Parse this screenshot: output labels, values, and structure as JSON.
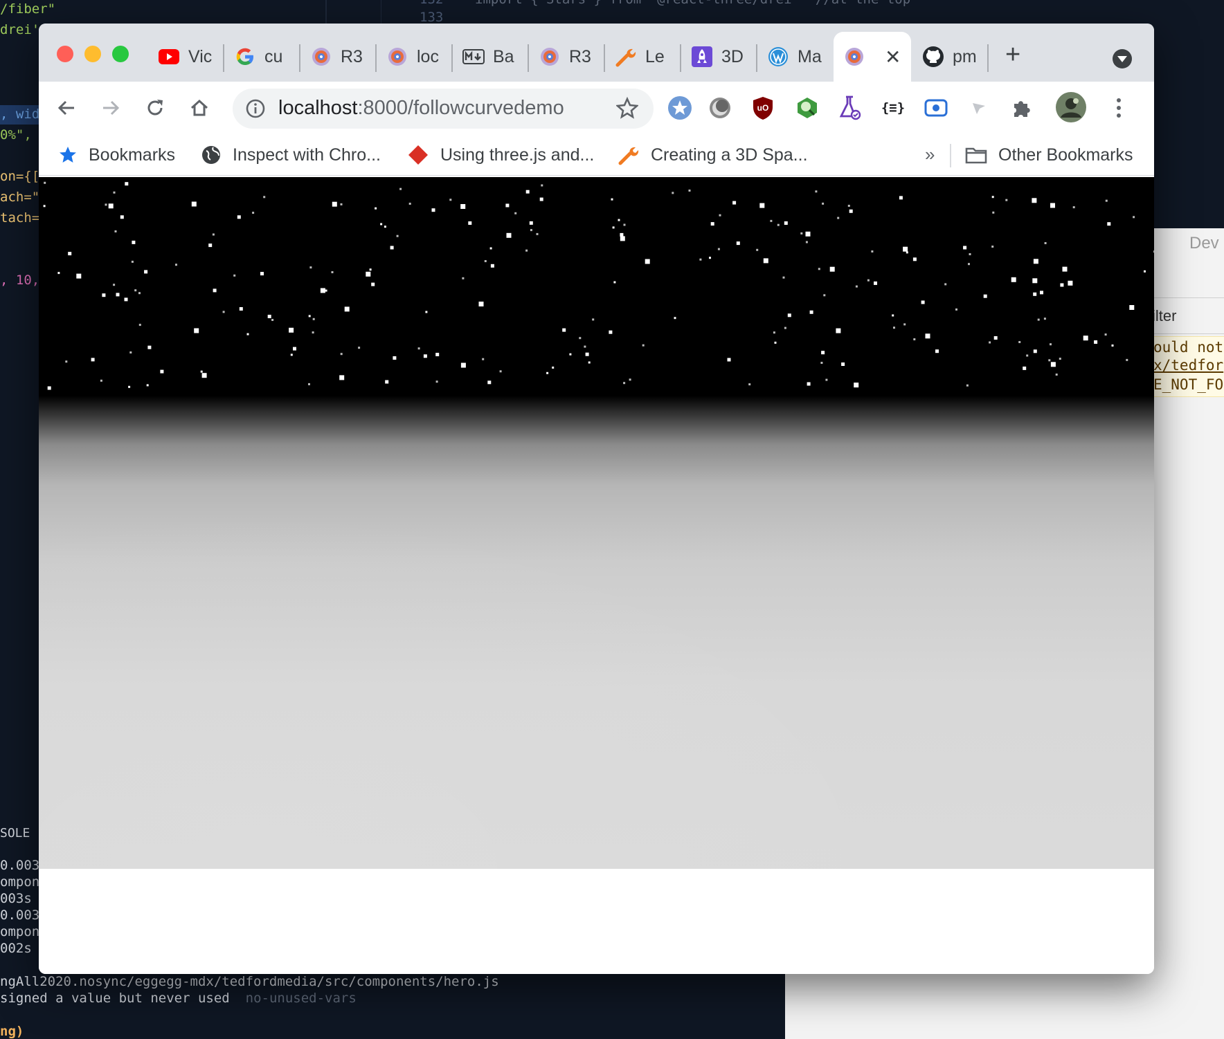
{
  "editor": {
    "top_fragments": [
      "/fiber\"",
      "drei'"
    ],
    "code_line_1": "import { Stars } from '@react-three/drei'  //at the top",
    "line_no_132": "132",
    "line_no_133": "133",
    "left_fragments": [
      ", wid",
      "0%\", ",
      "on={[",
      "ach=\"",
      "tach=\"",
      ", 10,"
    ],
    "console_label": "SOLE",
    "console_lines": [
      "0.003s",
      "ompone",
      "003s",
      "0.003s",
      "ompone",
      "002s"
    ],
    "path_line": "ngAll2020.nosync/eggegg-mdx/tedfordmedia/src/components/hero.js",
    "warn_line": "signed a value but never used",
    "warn_rule": "no-unused-vars",
    "last_line": "ng)"
  },
  "devtools": {
    "title": "Dev",
    "filter": "ilter",
    "error_lines": [
      "ould not",
      "x/tedfor",
      "E_NOT_FO"
    ]
  },
  "browser": {
    "tabs": [
      {
        "label": "Vic",
        "icon": "youtube-icon"
      },
      {
        "label": "cu",
        "icon": "google-icon"
      },
      {
        "label": "R3",
        "icon": "r3f-icon"
      },
      {
        "label": "loc",
        "icon": "r3f-icon"
      },
      {
        "label": "Ba",
        "icon": "markdown-icon"
      },
      {
        "label": "R3",
        "icon": "r3f-icon"
      },
      {
        "label": "Le",
        "icon": "wrench-icon"
      },
      {
        "label": "3D",
        "icon": "rocket-icon"
      },
      {
        "label": "Ma",
        "icon": "wordpress-icon"
      },
      {
        "label": "",
        "icon": "r3f-icon",
        "active": true
      },
      {
        "label": "pm",
        "icon": "github-icon"
      }
    ],
    "new_tab": "+",
    "address": {
      "host": "localhost",
      "path": ":8000/followcurvedemo"
    },
    "bookmarks": [
      {
        "label": "Bookmarks",
        "icon": "star-icon"
      },
      {
        "label": "Inspect with Chro...",
        "icon": "globe-icon"
      },
      {
        "label": "Using three.js and...",
        "icon": "diamond-icon"
      },
      {
        "label": "Creating a 3D Spa...",
        "icon": "wrench-icon"
      }
    ],
    "bookmarks_more": "»",
    "other_bookmarks": "Other Bookmarks",
    "colors": {
      "tabstrip": "#dee1e6",
      "sky": "#000000",
      "ground": "#d8d8d8"
    }
  }
}
